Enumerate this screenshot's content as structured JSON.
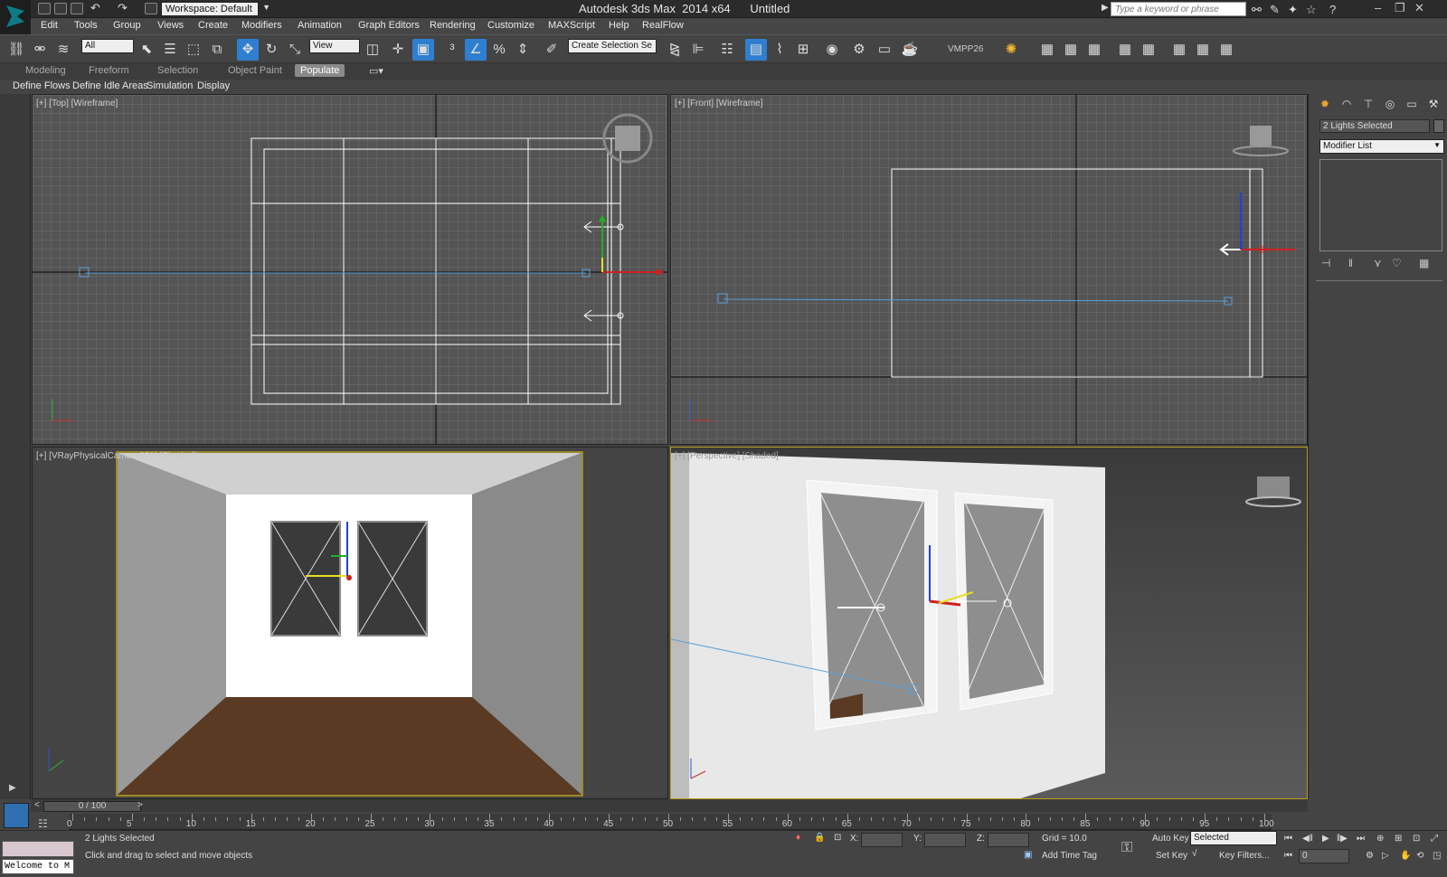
{
  "title": "Autodesk 3ds Max  2014 x64      Untitled",
  "workspace": "Workspace: Default",
  "search": {
    "placeholder": "Type a keyword or phrase"
  },
  "menus": [
    "Edit",
    "Tools",
    "Group",
    "Views",
    "Create",
    "Modifiers",
    "Animation",
    "Graph Editors",
    "Rendering",
    "Customize",
    "MAXScript",
    "Help",
    "RealFlow"
  ],
  "toolbar": {
    "filter": "All",
    "ref_coord": "View",
    "selection_set": "Create Selection Se",
    "plugin_label": "VMPP26"
  },
  "ribbon_tabs": [
    "Modeling",
    "Freeform",
    "Selection",
    "Object Paint",
    "Populate"
  ],
  "ribbon_active": "Populate",
  "populate_panels": [
    "Define Flows",
    "Define Idle Areas",
    "Simulation",
    "Display"
  ],
  "viewports": {
    "top": "[+] [Top] [Wireframe]",
    "front": "[+] [Front] [Wireframe]",
    "camera": "[+] [VRayPhysicalCamera001] [Shaded]",
    "perspective": "[+] [Perspective] [Shaded]"
  },
  "command_panel": {
    "selection": "2 Lights Selected",
    "modifier_list": "Modifier List"
  },
  "timeline": {
    "slider": "0 / 100",
    "ticks": [
      "0",
      "5",
      "10",
      "15",
      "20",
      "25",
      "30",
      "35",
      "40",
      "45",
      "50",
      "55",
      "60",
      "65",
      "70",
      "75",
      "80",
      "85",
      "90",
      "95",
      "100"
    ]
  },
  "status": {
    "selection": "2 Lights Selected",
    "prompt": "Click and drag to select and move objects",
    "welcome": "Welcome to M",
    "x_label": "X:",
    "y_label": "Y:",
    "z_label": "Z:",
    "grid": "Grid = 10.0",
    "add_time_tag": "Add Time Tag",
    "auto_key": "Auto Key",
    "set_key": "Set Key",
    "key_mode": "Selected",
    "key_filters": "Key Filters...",
    "frame": "0"
  },
  "colors": {
    "accent": "#2f7fd0",
    "light_line": "#5aa0d8",
    "floor": "#5a3a22"
  }
}
